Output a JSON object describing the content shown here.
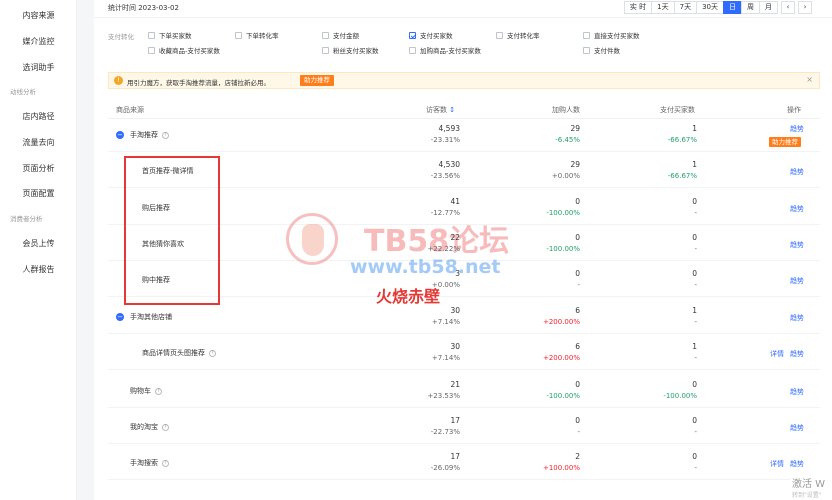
{
  "sidebar": {
    "items": [
      {
        "label": "内容来源"
      },
      {
        "label": "媒介监控"
      },
      {
        "label": "选词助手"
      },
      {
        "label": "店内路径"
      },
      {
        "label": "流量去向"
      },
      {
        "label": "页面分析"
      },
      {
        "label": "页面配置"
      },
      {
        "label": "会员上传"
      },
      {
        "label": "人群报告"
      }
    ],
    "sections": [
      {
        "label": "动线分析"
      },
      {
        "label": "消费者分析"
      }
    ]
  },
  "topbar": {
    "stat_time": "统计时间 2023-03-02",
    "buttons": [
      {
        "label": "实 时"
      },
      {
        "label": "1天"
      },
      {
        "label": "7天"
      },
      {
        "label": "30天"
      },
      {
        "label": "日"
      },
      {
        "label": "周"
      },
      {
        "label": "月"
      }
    ],
    "prev": "‹",
    "next": "›"
  },
  "filters": {
    "label": "支付转化",
    "options": [
      {
        "label": "下单买家数",
        "checked": false
      },
      {
        "label": "下单转化率",
        "checked": false
      },
      {
        "label": "支付金额",
        "checked": false
      },
      {
        "label": "支付买家数",
        "checked": true
      },
      {
        "label": "支付转化率",
        "checked": false
      },
      {
        "label": "直接支付买家数",
        "checked": false
      },
      {
        "label": "收藏商品-支付买家数",
        "checked": false
      },
      {
        "label": "粉丝支付买家数",
        "checked": false
      },
      {
        "label": "加购商品-支付买家数",
        "checked": false
      },
      {
        "label": "支付件数",
        "checked": false
      }
    ]
  },
  "notice": {
    "icon": "!",
    "text": "用引力魔方，获取手淘推荐流量，店铺拉新必用。",
    "button": "助力推荐",
    "close": "×"
  },
  "table": {
    "headers": {
      "source": "商品来源",
      "visitors": "访客数",
      "cart": "加购人数",
      "buyers": "支付买家数",
      "op": "操作"
    },
    "sort_icon": "↕",
    "rows": [
      {
        "name": "手淘推荐",
        "expand": "−",
        "help": "?",
        "v": "4,593",
        "vs": "-23.31%",
        "c": "29",
        "cs": "-6.45%",
        "b": "1",
        "bs": "-66.67%",
        "op1": "趋势",
        "op_btn": "助力推荐"
      },
      {
        "name": "首页推荐-微详情",
        "v": "4,530",
        "vs": "-23.56%",
        "c": "29",
        "cs": "+0.00%",
        "b": "1",
        "bs": "-66.67%",
        "op1": "趋势"
      },
      {
        "name": "购后推荐",
        "v": "41",
        "vs": "-12.77%",
        "c": "0",
        "cs": "-100.00%",
        "b": "0",
        "bs": "-",
        "op1": "趋势"
      },
      {
        "name": "其他猜你喜欢",
        "v": "22",
        "vs": "+22.22%",
        "c": "0",
        "cs": "-100.00%",
        "b": "0",
        "bs": "-",
        "op1": "趋势"
      },
      {
        "name": "购中推荐",
        "v": "3",
        "vs": "+0.00%",
        "c": "0",
        "cs": "-",
        "b": "0",
        "bs": "-",
        "op1": "趋势"
      },
      {
        "name": "手淘其他店铺",
        "expand": "−",
        "v": "30",
        "vs": "+7.14%",
        "c": "6",
        "cs": "+200.00%",
        "b": "1",
        "bs": "-",
        "op1": "趋势"
      },
      {
        "name": "商品详情页头图推荐",
        "help": "?",
        "v": "30",
        "vs": "+7.14%",
        "c": "6",
        "cs": "+200.00%",
        "b": "1",
        "bs": "-",
        "op0": "详情",
        "op1": "趋势"
      },
      {
        "name": "购物车",
        "help": "?",
        "v": "21",
        "vs": "+23.53%",
        "c": "0",
        "cs": "-100.00%",
        "b": "0",
        "bs": "-100.00%",
        "op1": "趋势"
      },
      {
        "name": "我的淘宝",
        "help": "?",
        "v": "17",
        "vs": "-22.73%",
        "c": "0",
        "cs": "-",
        "b": "0",
        "bs": "-",
        "op1": "趋势"
      },
      {
        "name": "手淘搜索",
        "help": "?",
        "v": "17",
        "vs": "-26.09%",
        "c": "2",
        "cs": "+100.00%",
        "b": "0",
        "bs": "-",
        "op0": "详情",
        "op1": "趋势"
      }
    ]
  },
  "watermark": {
    "title": "TB58论坛",
    "url": "www.tb58.net",
    "annotation": "火烧赤壁"
  },
  "activate": {
    "line1": "激活 W",
    "line2": "转到\"设置\""
  },
  "colors": {
    "accent": "#2f6bff",
    "orange": "#ff7d1a",
    "red": "#f5222d",
    "green": "#22a06b",
    "box": "#e53935"
  }
}
